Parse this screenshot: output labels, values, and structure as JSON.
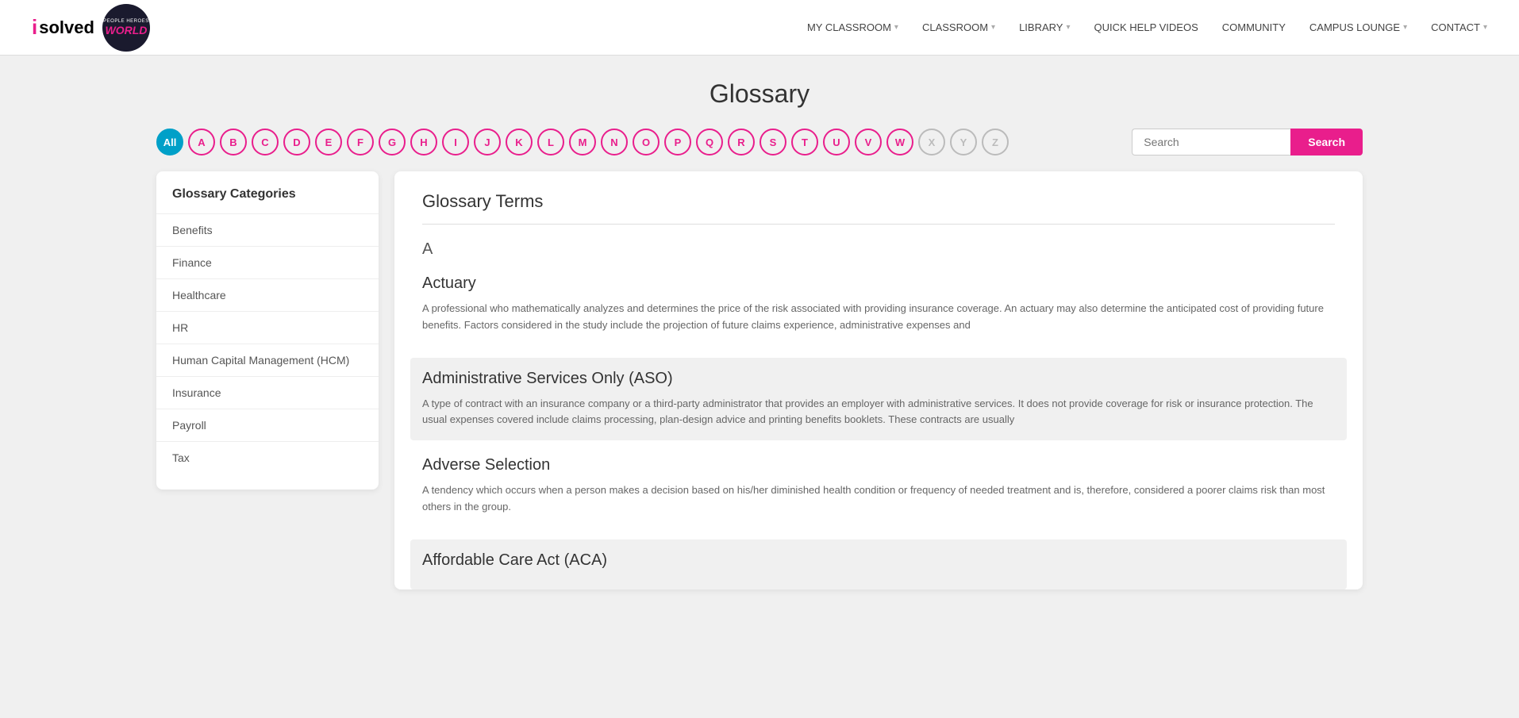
{
  "header": {
    "logo_isolved": "isolved",
    "logo_world_line1": "PEOPLE HEROES",
    "logo_world_line2": "WORLD",
    "nav_items": [
      {
        "label": "MY CLASSROOM",
        "has_arrow": true
      },
      {
        "label": "CLASSROOM",
        "has_arrow": true
      },
      {
        "label": "LIBRARY",
        "has_arrow": true
      },
      {
        "label": "QUICK HELP VIDEOS",
        "has_arrow": false
      },
      {
        "label": "COMMUNITY",
        "has_arrow": false
      },
      {
        "label": "CAMPUS LOUNGE",
        "has_arrow": true
      },
      {
        "label": "CONTACT",
        "has_arrow": true
      }
    ]
  },
  "page": {
    "title": "Glossary",
    "search_placeholder": "Search",
    "search_button": "Search"
  },
  "alphabet": {
    "active": "All",
    "letters": [
      "All",
      "A",
      "B",
      "C",
      "D",
      "E",
      "F",
      "G",
      "H",
      "I",
      "J",
      "K",
      "L",
      "M",
      "N",
      "O",
      "P",
      "Q",
      "R",
      "S",
      "T",
      "U",
      "V",
      "W",
      "X",
      "Y",
      "Z"
    ],
    "inactive_letters": [
      "X",
      "Y",
      "Z"
    ]
  },
  "sidebar": {
    "title": "Glossary Categories",
    "items": [
      {
        "label": "Benefits"
      },
      {
        "label": "Finance"
      },
      {
        "label": "Healthcare"
      },
      {
        "label": "HR"
      },
      {
        "label": "Human Capital Management (HCM)"
      },
      {
        "label": "Insurance"
      },
      {
        "label": "Payroll"
      },
      {
        "label": "Tax"
      }
    ]
  },
  "content": {
    "title": "Glossary Terms",
    "current_letter": "A",
    "entries": [
      {
        "id": "actuary",
        "title": "Actuary",
        "highlighted": false,
        "text": "A professional who mathematically analyzes and determines the price of the risk associated with providing insurance coverage. An actuary may also determine the anticipated cost of providing future benefits. Factors considered in the study include the projection of future claims experience, administrative expenses and"
      },
      {
        "id": "aso",
        "title": "Administrative Services Only (ASO)",
        "highlighted": true,
        "text": "A type of contract with an insurance company or a third-party administrator that provides an employer with administrative services. It does not provide coverage for risk or insurance protection. The usual expenses covered include claims processing, plan-design advice and printing benefits booklets. These contracts are usually"
      },
      {
        "id": "adverse-selection",
        "title": "Adverse Selection",
        "highlighted": false,
        "text": "A tendency which occurs when a person makes a decision based on his/her diminished health condition or frequency of needed treatment and is, therefore, considered a poorer claims risk than most others in the group."
      },
      {
        "id": "aca",
        "title": "Affordable Care Act (ACA)",
        "highlighted": true,
        "text": ""
      }
    ]
  }
}
